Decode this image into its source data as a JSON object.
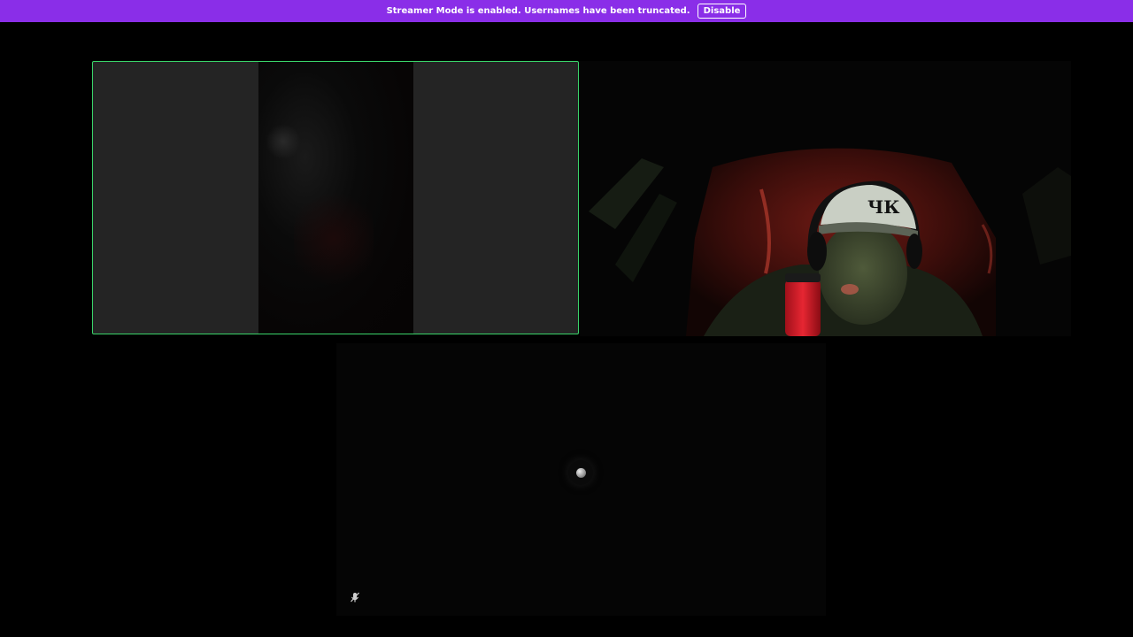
{
  "banner": {
    "message": "Streamer Mode is enabled. Usernames have been truncated.",
    "disable_label": "Disable",
    "color": "#8a2ee8"
  },
  "tiles": {
    "screen_share": {
      "border_color": "#3ad46a"
    },
    "camera": {},
    "empty": {
      "avatar_icon": "avatar-icon",
      "status_icon": "microphone-muted-icon"
    }
  }
}
